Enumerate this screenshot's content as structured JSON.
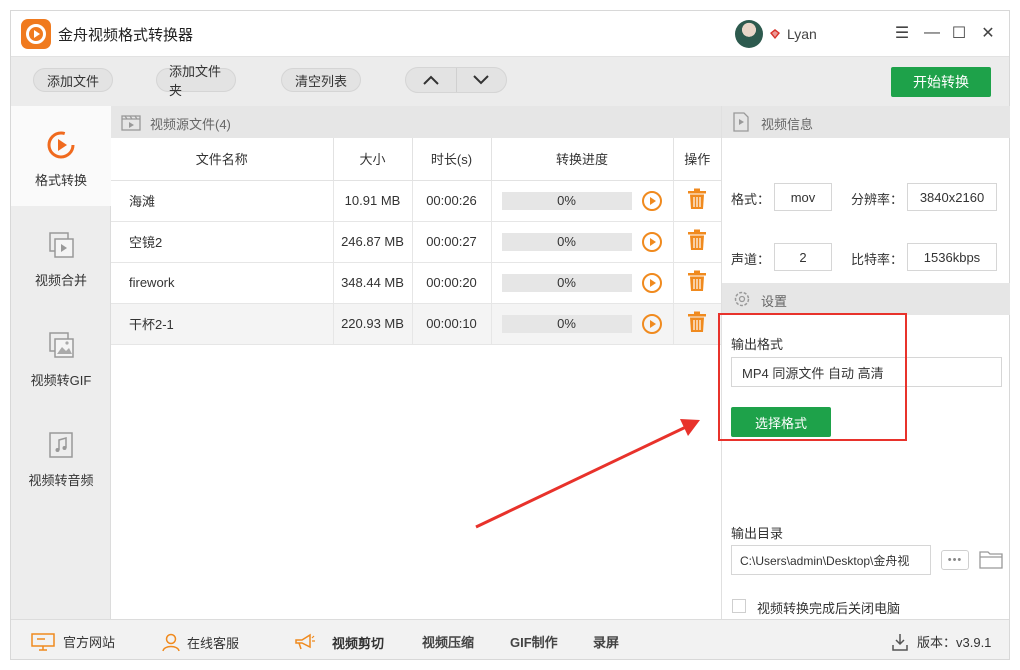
{
  "app": {
    "title": "金舟视频格式转换器",
    "user_name": "Lyan"
  },
  "window_controls": {
    "menu": "☰",
    "minimize": "—",
    "maximize": "☐",
    "close": "✕"
  },
  "toolbar": {
    "add_file": "添加文件",
    "add_folder": "添加文件夹",
    "clear_list": "清空列表",
    "move_up": "∧",
    "move_down": "∨",
    "start": "开始转换"
  },
  "sidebar": {
    "items": [
      {
        "label": "格式转换",
        "icon": "format-convert-icon",
        "active": true
      },
      {
        "label": "视频合并",
        "icon": "video-merge-icon",
        "active": false
      },
      {
        "label": "视频转GIF",
        "icon": "video-gif-icon",
        "active": false
      },
      {
        "label": "视频转音频",
        "icon": "video-audio-icon",
        "active": false
      }
    ]
  },
  "files": {
    "header": "视频源文件(4)",
    "columns": {
      "name": "文件名称",
      "size": "大小",
      "duration": "时长(s)",
      "progress": "转换进度",
      "action": "操作"
    },
    "rows": [
      {
        "name": "海滩",
        "size": "10.91 MB",
        "duration": "00:00:26",
        "progress": "0%"
      },
      {
        "name": "空镜2",
        "size": "246.87 MB",
        "duration": "00:00:27",
        "progress": "0%"
      },
      {
        "name": "firework",
        "size": "348.44 MB",
        "duration": "00:00:20",
        "progress": "0%"
      },
      {
        "name": "干杯2-1",
        "size": "220.93 MB",
        "duration": "00:00:10",
        "progress": "0%"
      }
    ]
  },
  "video_info": {
    "header": "视频信息",
    "format_label": "格式：",
    "format_value": "mov",
    "resolution_label": "分辨率：",
    "resolution_value": "3840x2160",
    "channels_label": "声道：",
    "channels_value": "2",
    "bitrate_label": "比特率：",
    "bitrate_value": "1536kbps"
  },
  "settings": {
    "header": "设置",
    "output_format_label": "输出格式",
    "output_format_value": "MP4 同源文件 自动 高清",
    "choose_format": "选择格式",
    "output_dir_label": "输出目录",
    "output_dir_value": "C:\\Users\\admin\\Desktop\\金舟视",
    "dots": "•••",
    "shutdown_label": "视频转换完成后关闭电脑"
  },
  "bottom": {
    "website": "官方网站",
    "support": "在线客服",
    "cut": "视频剪切",
    "compress": "视频压缩",
    "gif": "GIF制作",
    "record": "录屏",
    "version": "版本：v3.9.1"
  },
  "colors": {
    "accent_green": "#1ea24a",
    "accent_orange": "#f08a1e",
    "annotation_red": "#e8322b"
  }
}
